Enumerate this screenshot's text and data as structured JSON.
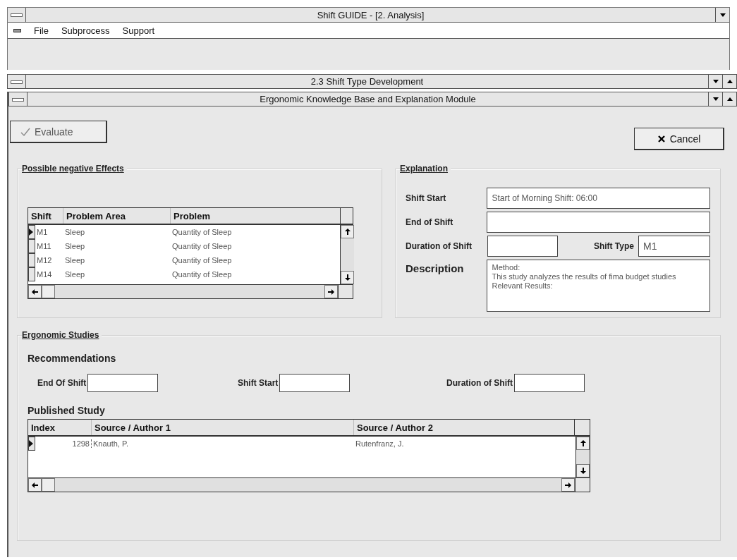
{
  "window": {
    "title": "Shift GUIDE - [2. Analysis]"
  },
  "menu": [
    "File",
    "Subprocess",
    "Support"
  ],
  "child_window": {
    "title": "2.3 Shift Type Development"
  },
  "module_window": {
    "title": "Ergonomic Knowledge Base and Explanation Module"
  },
  "evaluate_button": {
    "label": "Evaluate"
  },
  "cancel_button": {
    "label": "Cancel"
  },
  "effects": {
    "title": "Possible negative Effects",
    "columns": [
      "Shift",
      "Problem Area",
      "Problem"
    ],
    "rows": [
      {
        "cells": [
          "M1",
          "Sleep",
          "Quantity of Sleep"
        ],
        "selected": true
      },
      {
        "cells": [
          "M11",
          "Sleep",
          "Quantity of Sleep"
        ],
        "selected": false
      },
      {
        "cells": [
          "M12",
          "Sleep",
          "Quantity of Sleep"
        ],
        "selected": false
      },
      {
        "cells": [
          "M14",
          "Sleep",
          "Quantity of Sleep"
        ],
        "selected": false
      }
    ]
  },
  "explanation": {
    "title": "Explanation",
    "shift_start": {
      "label": "Shift Start",
      "value": "Start of Morning Shift: 06:00"
    },
    "end_of_shift": {
      "label": "End of Shift"
    },
    "duration": {
      "label": "Duration of Shift"
    },
    "shift_type": {
      "label": "Shift Type",
      "value": "M1"
    },
    "description": {
      "label": "Description",
      "value": "Method:\nThis study analyzes the results of fima budget studies\nRelevant Results:"
    }
  },
  "studies": {
    "title": "Ergonomic Studies",
    "recommendations": {
      "title": "Recommendations",
      "fields": [
        {
          "label": "End Of Shift"
        },
        {
          "label": "Shift Start"
        },
        {
          "label": "Duration of Shift"
        }
      ]
    },
    "published": {
      "title": "Published Study",
      "columns": [
        "Index",
        "Source / Author 1",
        "Source / Author 2"
      ],
      "rows": [
        {
          "cells": [
            "1298",
            "Knauth, P.",
            "Rutenfranz, J."
          ],
          "selected": true
        }
      ]
    }
  }
}
